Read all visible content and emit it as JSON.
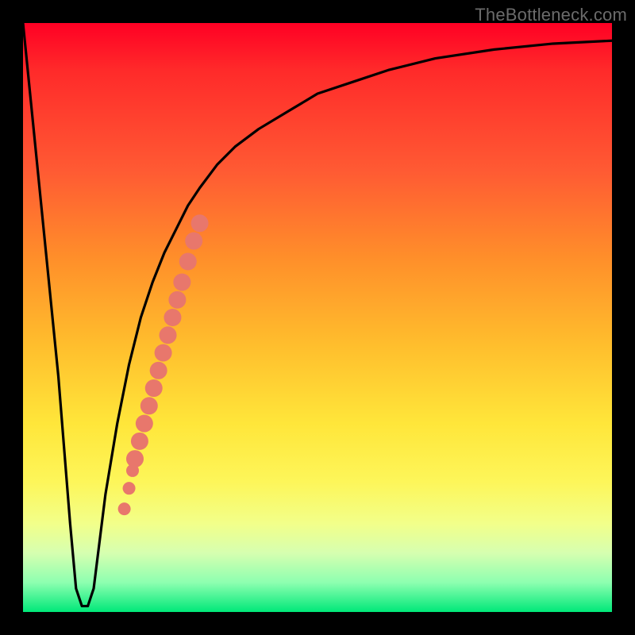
{
  "watermark": "TheBottleneck.com",
  "chart_data": {
    "type": "line",
    "title": "",
    "xlabel": "",
    "ylabel": "",
    "xlim": [
      0,
      100
    ],
    "ylim": [
      0,
      100
    ],
    "grid": false,
    "legend": false,
    "annotations": [],
    "series": [
      {
        "name": "bottleneck-curve",
        "color": "#000000",
        "x": [
          0,
          3,
          6,
          8,
          9,
          10,
          11,
          12,
          13,
          14,
          16,
          18,
          20,
          22,
          24,
          26,
          28,
          30,
          33,
          36,
          40,
          45,
          50,
          56,
          62,
          70,
          80,
          90,
          100
        ],
        "y": [
          100,
          70,
          40,
          15,
          4,
          1,
          1,
          4,
          12,
          20,
          32,
          42,
          50,
          56,
          61,
          65,
          69,
          72,
          76,
          79,
          82,
          85,
          88,
          90,
          92,
          94,
          95.5,
          96.5,
          97
        ]
      },
      {
        "name": "highlight-band",
        "color": "#e8776c",
        "type": "scatter",
        "x": [
          19.0,
          19.8,
          20.6,
          21.4,
          22.2,
          23.0,
          23.8,
          24.6,
          25.4,
          26.2,
          27.0,
          28.0,
          29.0,
          30.0
        ],
        "y": [
          26.0,
          29.0,
          32.0,
          35.0,
          38.0,
          41.0,
          44.0,
          47.0,
          50.0,
          53.0,
          56.0,
          59.5,
          63.0,
          66.0
        ],
        "marker_radius_px": 11
      },
      {
        "name": "highlight-dots-lower",
        "color": "#e8776c",
        "type": "scatter",
        "x": [
          17.2,
          18.0,
          18.6
        ],
        "y": [
          17.5,
          21.0,
          24.0
        ],
        "marker_radius_px": 8
      }
    ]
  }
}
